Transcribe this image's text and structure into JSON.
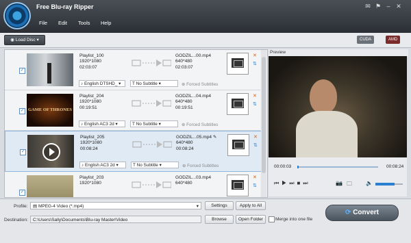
{
  "app": {
    "title": "Free Blu-ray Ripper"
  },
  "menu": [
    "File",
    "Edit",
    "Tools",
    "Help"
  ],
  "toolbar": {
    "load_disc": "Load Disc",
    "cuda": "CUDA",
    "amd": "AMD"
  },
  "items": [
    {
      "title": "Playlist_100",
      "res": "1920*1080",
      "dur": "02:03:07",
      "out_name": "GODZIL...00.mp4",
      "out_res": "640*480",
      "out_dur": "02:03:07",
      "audio": "English DTSHD_",
      "subtitle": "No Subtitle",
      "forced": "Forced Subtitles"
    },
    {
      "title": "Playlist_204",
      "res": "1920*1080",
      "dur": "00:19:51",
      "out_name": "GODZIL...04.mp4",
      "out_res": "640*480",
      "out_dur": "00:19:51",
      "audio": "English AC3 2d",
      "subtitle": "No Subtitle",
      "forced": "Forced Subtitles",
      "thumb_text": "GAME OF THRONES"
    },
    {
      "title": "Playlist_205",
      "res": "1920*1080",
      "dur": "00:08:24",
      "out_name": "GODZIL...05.mp4",
      "out_res": "640*480",
      "out_dur": "00:08:24",
      "audio": "English AC3 2d",
      "subtitle": "No Subtitle",
      "forced": "Forced Subtitles"
    },
    {
      "title": "Playlist_203",
      "res": "1920*1080",
      "dur": "",
      "out_name": "GODZIL...03.mp4",
      "out_res": "640*480",
      "out_dur": ""
    }
  ],
  "preview": {
    "label": "Preview",
    "time_current": "00:00:03",
    "time_total": "00:08:24",
    "progress": 0.02,
    "volume": 0.7
  },
  "bottom": {
    "profile_label": "Profile:",
    "profile_value": "MPEG-4 Video (*.mp4)",
    "settings": "Settings",
    "apply_all": "Apply to All",
    "destination_label": "Destination:",
    "destination_value": "C:\\Users\\Sally\\Documents\\Blu-ray Master\\Video",
    "browse": "Browse",
    "open_folder": "Open Folder",
    "merge": "Merge into one file",
    "convert": "Convert"
  },
  "colors": {
    "accent": "#2a7fd0",
    "orange": "#e06010"
  }
}
